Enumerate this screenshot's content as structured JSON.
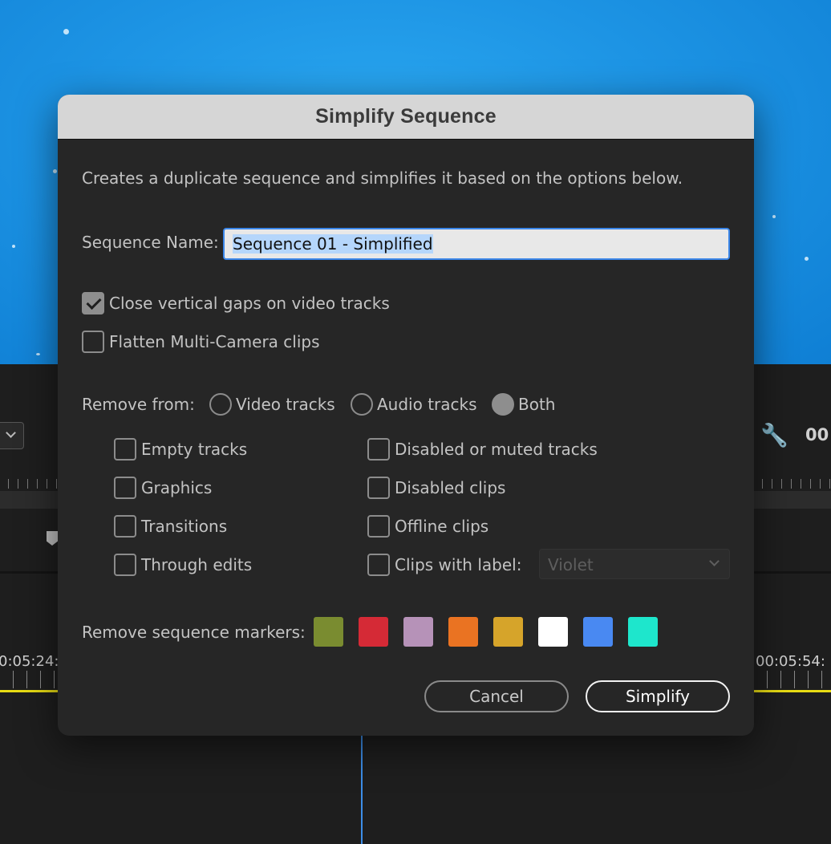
{
  "background": {
    "timecode_top": "00",
    "timecode_left": "0:05:24:",
    "timecode_right": "00:05:54:"
  },
  "dialog": {
    "title": "Simplify Sequence",
    "description": "Creates a duplicate sequence and simplifies it based on the options below.",
    "sequence_name_label": "Sequence Name:",
    "sequence_name_value": "Sequence 01 - Simplified",
    "close_gaps_label": "Close vertical gaps on video tracks",
    "close_gaps_checked": true,
    "flatten_label": "Flatten Multi-Camera clips",
    "flatten_checked": false,
    "remove_from_label": "Remove from:",
    "remove_from_options": [
      {
        "label": "Video tracks",
        "selected": false
      },
      {
        "label": "Audio tracks",
        "selected": false
      },
      {
        "label": "Both",
        "selected": true
      }
    ],
    "left_options": [
      {
        "label": "Empty tracks",
        "checked": false
      },
      {
        "label": "Graphics",
        "checked": false
      },
      {
        "label": "Transitions",
        "checked": false
      },
      {
        "label": "Through edits",
        "checked": false
      }
    ],
    "right_options": [
      {
        "label": "Disabled or muted tracks",
        "checked": false
      },
      {
        "label": "Disabled clips",
        "checked": false
      },
      {
        "label": "Offline clips",
        "checked": false
      },
      {
        "label": "Clips with label:",
        "checked": false
      }
    ],
    "label_select_value": "Violet",
    "markers_label": "Remove sequence markers:",
    "marker_colors": [
      "#7a8c30",
      "#d52a36",
      "#b692b8",
      "#ea7322",
      "#d6a42a",
      "#ffffff",
      "#4989f2",
      "#1ee6cc"
    ],
    "cancel_label": "Cancel",
    "simplify_label": "Simplify"
  }
}
